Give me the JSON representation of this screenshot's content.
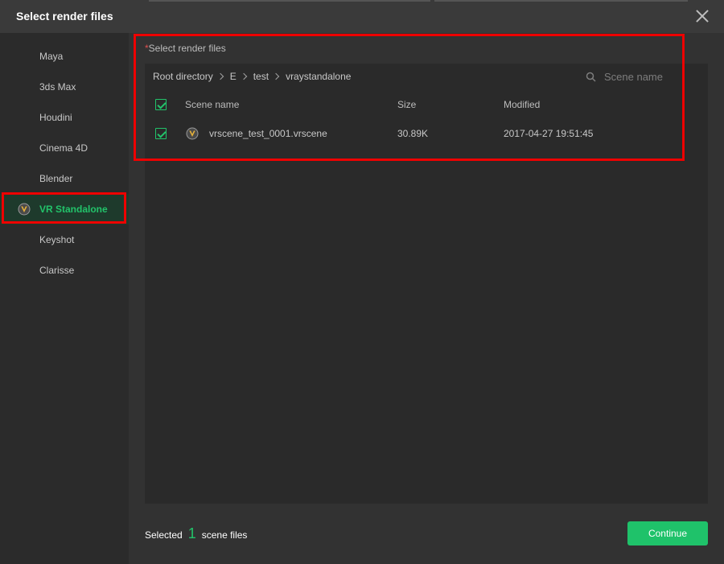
{
  "dialog": {
    "title": "Select render files"
  },
  "sidebar": {
    "items": [
      {
        "label": "Maya"
      },
      {
        "label": "3ds Max"
      },
      {
        "label": "Houdini"
      },
      {
        "label": "Cinema 4D"
      },
      {
        "label": "Blender"
      },
      {
        "label": "VR Standalone",
        "active": true,
        "icon": "vray-logo-icon"
      },
      {
        "label": "Keyshot"
      },
      {
        "label": "Clarisse"
      }
    ]
  },
  "files": {
    "section_label": "Select render files",
    "required_marker": "*",
    "breadcrumb": [
      "Root directory",
      "E",
      "test",
      "vraystandalone"
    ],
    "search_placeholder": "Scene name",
    "columns": {
      "name": "Scene name",
      "size": "Size",
      "modified": "Modified"
    },
    "header_checked": true,
    "rows": [
      {
        "checked": true,
        "icon": "vray-logo-icon",
        "name": "vrscene_test_0001.vrscene",
        "size": "30.89K",
        "modified": "2017-04-27 19:51:45"
      }
    ]
  },
  "footer": {
    "selected_prefix": "Selected",
    "selected_count": "1",
    "selected_suffix": "scene files",
    "continue_label": "Continue"
  },
  "colors": {
    "accent": "#22c36a",
    "highlight": "#ee0000",
    "background": "#2b2b2b"
  }
}
